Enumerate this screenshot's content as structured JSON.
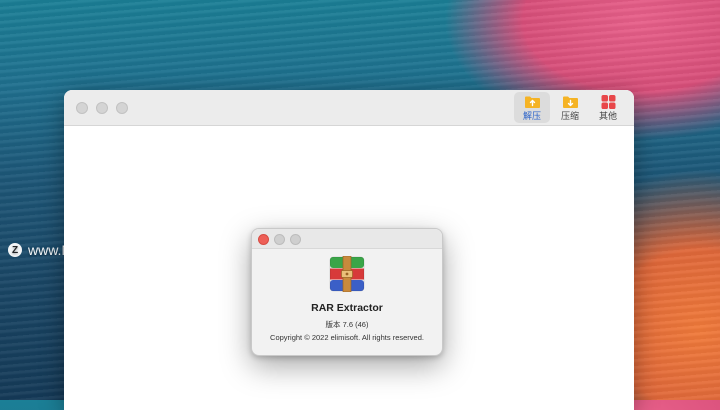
{
  "watermark": {
    "logo": "Z",
    "text": "www.MacZ.com"
  },
  "toolbar": {
    "items": [
      {
        "label": "解压",
        "icon": "extract-folder-icon",
        "active": true
      },
      {
        "label": "压缩",
        "icon": "compress-folder-icon",
        "active": false
      },
      {
        "label": "其他",
        "icon": "grid-icon",
        "active": false
      }
    ]
  },
  "about": {
    "app_name": "RAR Extractor",
    "version": "版本 7.6 (46)",
    "copyright": "Copyright © 2022 elimisoft. All rights reserved."
  },
  "colors": {
    "accent": "#2a62c9",
    "folder": "#f5b324",
    "grid": "#e8474a",
    "close": "#ee5f57"
  }
}
